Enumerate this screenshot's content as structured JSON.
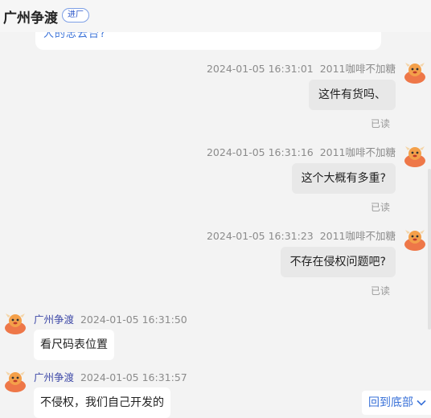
{
  "header": {
    "title": "广州争渡",
    "badge": "进厂"
  },
  "top_message": {
    "text": "人的忠云台?"
  },
  "messages": [
    {
      "direction": "out",
      "timestamp": "2024-01-05 16:31:01",
      "sender": "2011咖啡不加糖",
      "text": "这件有货吗、",
      "status": "已读"
    },
    {
      "direction": "out",
      "timestamp": "2024-01-05 16:31:16",
      "sender": "2011咖啡不加糖",
      "text": "这个大概有多重?",
      "status": "已读"
    },
    {
      "direction": "out",
      "timestamp": "2024-01-05 16:31:23",
      "sender": "2011咖啡不加糖",
      "text": "不存在侵权问题吧?",
      "status": "已读"
    },
    {
      "direction": "in",
      "sender": "广州争渡",
      "timestamp": "2024-01-05 16:31:50",
      "text": "看尺码表位置"
    },
    {
      "direction": "in",
      "sender": "广州争渡",
      "timestamp": "2024-01-05 16:31:57",
      "text": "不侵权，我们自己开发的"
    }
  ],
  "jump_button": {
    "label": "回到底部",
    "icon": "chevron-down-icon"
  },
  "colors": {
    "outgoing_bubble": "#e8e8e8",
    "incoming_bubble": "#ffffff",
    "accent": "#3a72d8",
    "avatar": "#ee7748"
  }
}
